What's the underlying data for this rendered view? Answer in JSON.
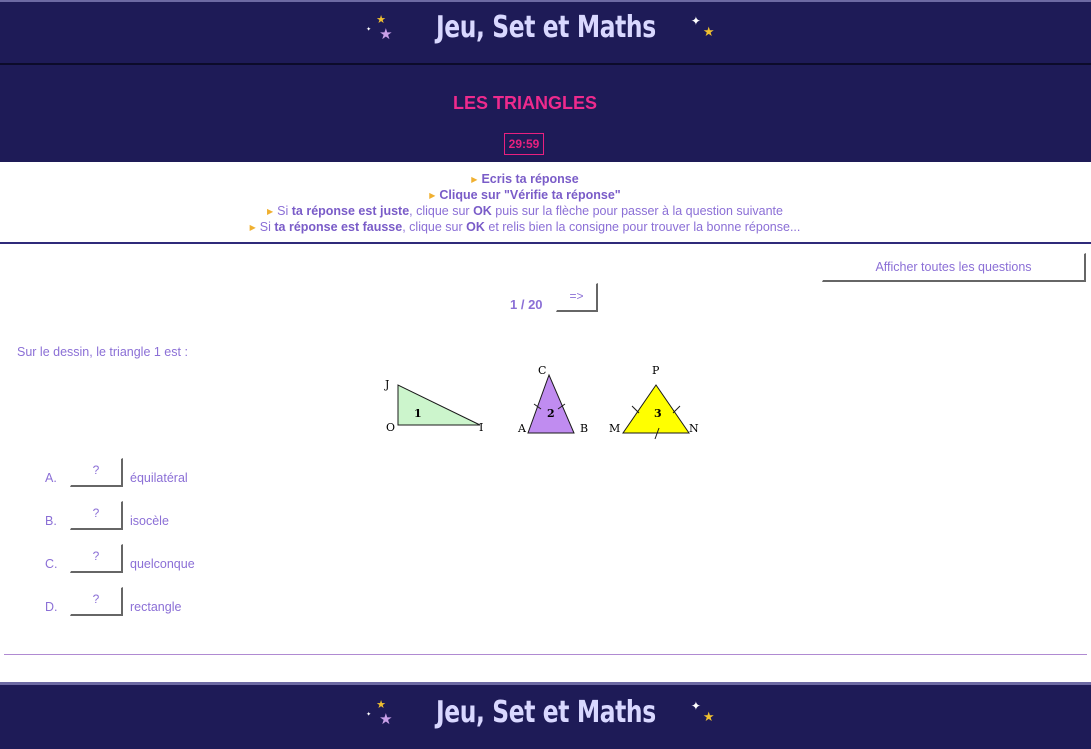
{
  "header": {
    "logo_text": "Jeu, Set et Maths"
  },
  "exercise": {
    "title": "LES TRIANGLES",
    "timer": "29:59"
  },
  "instructions": {
    "line1_bold": "Ecris ta réponse",
    "line2_bold": "Clique sur \"Vérifie ta réponse\"",
    "line3_a": "Si ",
    "line3_b": "ta réponse est juste",
    "line3_c": ", clique sur ",
    "line3_d": "OK",
    "line3_e": " puis sur la flèche pour passer à la question suivante",
    "line4_a": "Si ",
    "line4_b": "ta réponse est fausse",
    "line4_c": ", clique sur ",
    "line4_d": "OK",
    "line4_e": " et relis bien la consigne pour trouver la bonne réponse..."
  },
  "navigation": {
    "show_all_label": "Afficher toutes les questions",
    "counter": "1 / 20",
    "next_label": "=>"
  },
  "question": {
    "text": "Sur le dessin, le triangle 1 est :",
    "figure_labels": {
      "t1": {
        "J": "J",
        "O": "O",
        "I": "I",
        "num": "1"
      },
      "t2": {
        "C": "C",
        "A": "A",
        "B": "B",
        "num": "2"
      },
      "t3": {
        "P": "P",
        "M": "M",
        "N": "N",
        "num": "3"
      }
    },
    "triangle_colors": {
      "t1": "#ccf5cc",
      "t2": "#c08cf0",
      "t3": "#ffff00"
    },
    "options": [
      {
        "letter": "A.",
        "button": "?",
        "label": "équilatéral"
      },
      {
        "letter": "B.",
        "button": "?",
        "label": "isocèle"
      },
      {
        "letter": "C.",
        "button": "?",
        "label": "quelconque"
      },
      {
        "letter": "D.",
        "button": "?",
        "label": "rectangle"
      }
    ]
  },
  "footer": {
    "logo_text": "Jeu, Set et Maths"
  },
  "colors": {
    "navy": "#1e1b57",
    "accent_pink": "#ee2a8d",
    "text_purple": "#8b6fd6",
    "star_yellow": "#f0c030"
  }
}
